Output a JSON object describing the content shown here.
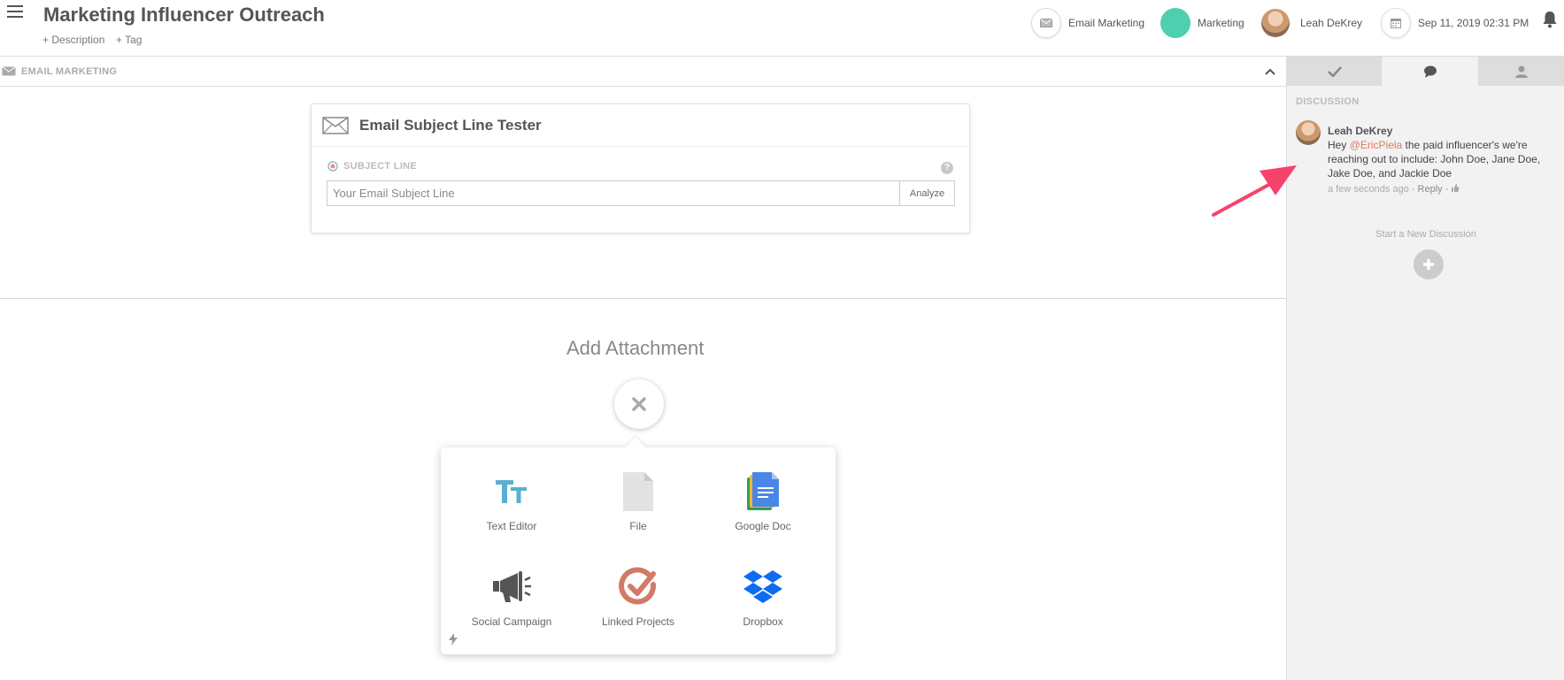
{
  "header": {
    "title": "Marketing Influencer Outreach",
    "add_description": "+ Description",
    "add_tag": "+ Tag",
    "type_label": "Email Marketing",
    "team_label": "Marketing",
    "team_color": "#4ecfb0",
    "user_name": "Leah DeKrey",
    "date": "Sep 11, 2019 02:31 PM"
  },
  "section": {
    "label": "EMAIL MARKETING"
  },
  "tester": {
    "title": "Email Subject Line Tester",
    "subject_label": "SUBJECT LINE",
    "help": "?",
    "input_placeholder": "Your Email Subject Line",
    "analyze_label": "Analyze"
  },
  "attachments": {
    "title": "Add Attachment",
    "items": [
      {
        "label": "Text Editor",
        "icon": "text-editor-icon"
      },
      {
        "label": "File",
        "icon": "file-icon"
      },
      {
        "label": "Google Doc",
        "icon": "google-doc-icon"
      },
      {
        "label": "Social Campaign",
        "icon": "megaphone-icon"
      },
      {
        "label": "Linked Projects",
        "icon": "linked-projects-icon"
      },
      {
        "label": "Dropbox",
        "icon": "dropbox-icon"
      }
    ]
  },
  "sidebar": {
    "heading": "DISCUSSION",
    "comment": {
      "author": "Leah DeKrey",
      "text_before": "Hey ",
      "mention": "@EricPiela",
      "text_after": " the paid influencer's we're reaching out to include: John Doe, Jane Doe, Jake Doe, and Jackie Doe",
      "time": "a few seconds ago",
      "separator": " - ",
      "reply": "Reply"
    },
    "new_discussion": "Start a New Discussion"
  },
  "colors": {
    "accent_arrow": "#f7436b",
    "mention": "#e07b5a"
  }
}
